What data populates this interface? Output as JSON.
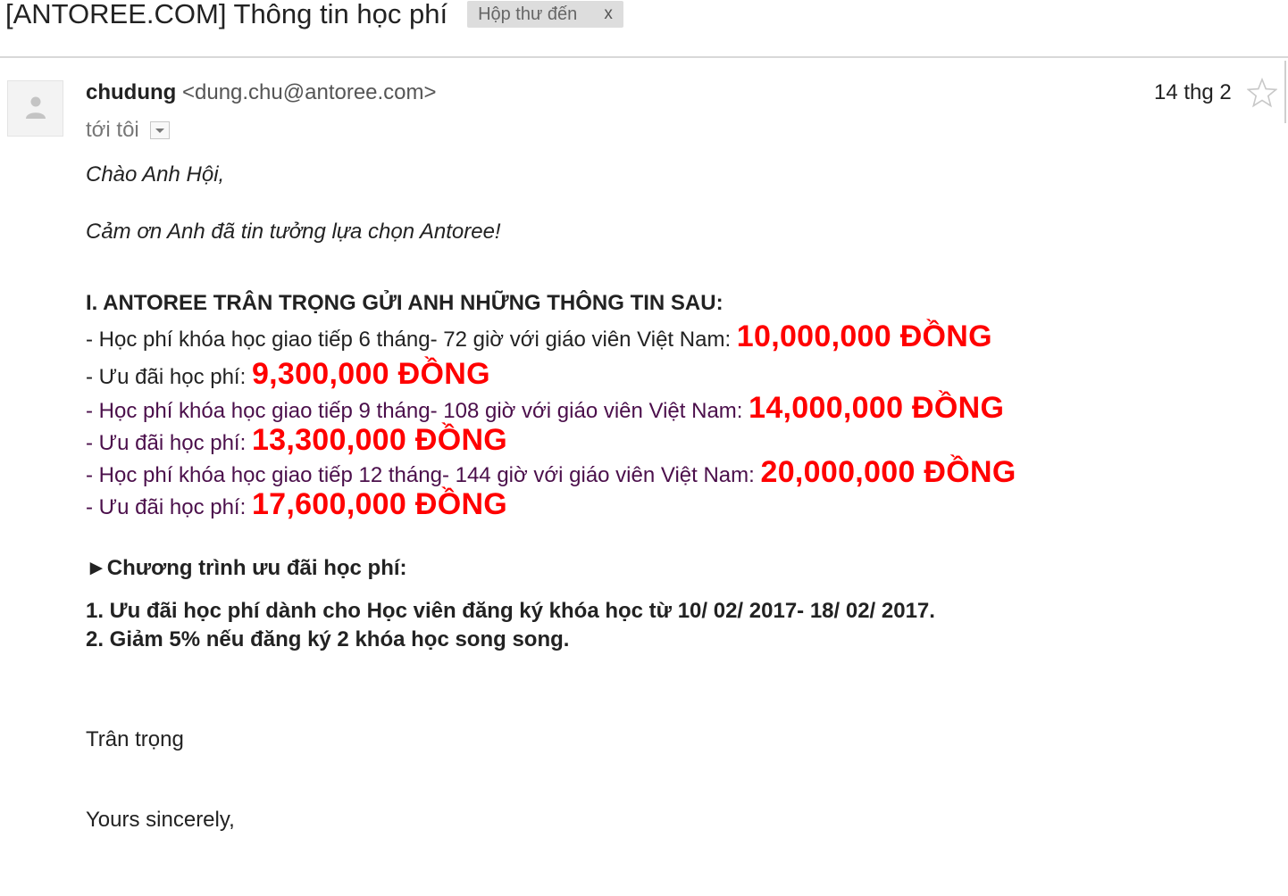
{
  "email": {
    "subject": "[ANTOREE.COM] Thông tin học phí",
    "label": "Hộp thư đến",
    "label_remove": "x",
    "sender_name": "chudung",
    "sender_email": "<dung.chu@antoree.com>",
    "recipient": "tới tôi",
    "date": "14 thg 2"
  },
  "body": {
    "greeting": "Chào Anh Hội,",
    "thanks": "Cảm ơn Anh đã tin tưởng lựa chọn Antoree!",
    "section_title": "I. ANTOREE TRÂN TRỌNG GỬI ANH NHỮNG THÔNG TIN SAU:",
    "fees": [
      {
        "label": "- Học phí khóa học giao tiếp 6 tháng- 72 giờ với giáo viên Việt Nam: ",
        "value": "10,000,000 ĐỒNG"
      },
      {
        "label": "- Ưu đãi học phí: ",
        "value": "9,300,000 ĐỒNG"
      },
      {
        "label": "- Học phí khóa học giao tiếp 9 tháng- 108 giờ với giáo viên Việt Nam: ",
        "value": "14,000,000 ĐỒNG"
      },
      {
        "label": "- Ưu đãi học phí: ",
        "value": "13,300,000 ĐỒNG"
      },
      {
        "label": "- Học phí khóa học giao tiếp 12 tháng- 144 giờ với giáo viên Việt Nam: ",
        "value": "20,000,000 ĐỒNG"
      },
      {
        "label": "- Ưu đãi học phí: ",
        "value": "17,600,000 ĐỒNG"
      }
    ],
    "program_title": "►Chương trình ưu đãi học phí:",
    "program_items": [
      "1. Ưu đãi học phí dành cho Học viên đăng ký khóa học từ 10/ 02/ 2017- 18/ 02/ 2017.",
      "2. Giảm 5% nếu đăng ký 2 khóa học song song."
    ],
    "closing": "Trân trọng",
    "signoff": "Yours sincerely,"
  },
  "colors": {
    "price": "#ff0000",
    "purple_text": "#4b0f4b",
    "label_chip": "#dddddd"
  },
  "icons": [
    "person-icon",
    "star-icon",
    "dropdown-arrow-icon"
  ]
}
